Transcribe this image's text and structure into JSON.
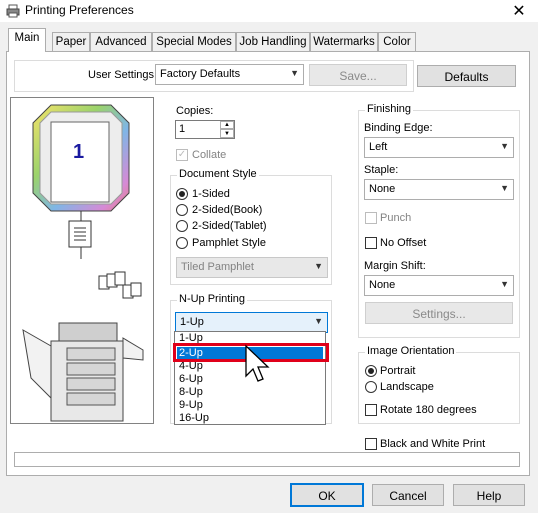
{
  "window": {
    "title": "Printing Preferences",
    "close_glyph": "✕"
  },
  "tabs": [
    "Main",
    "Paper",
    "Advanced",
    "Special Modes",
    "Job Handling",
    "Watermarks",
    "Color"
  ],
  "user_settings": {
    "label": "User Settings:",
    "value": "Factory Defaults",
    "save": "Save...",
    "defaults": "Defaults"
  },
  "preview": {
    "page_number": "1"
  },
  "copies": {
    "label": "Copies:",
    "value": "1",
    "collate": "Collate"
  },
  "document_style": {
    "title": "Document Style",
    "options": [
      "1-Sided",
      "2-Sided(Book)",
      "2-Sided(Tablet)",
      "Pamphlet Style"
    ],
    "selected": "1-Sided",
    "pamphlet_select": "Tiled Pamphlet"
  },
  "nup": {
    "title": "N-Up Printing",
    "value": "1-Up",
    "options": [
      "1-Up",
      "2-Up",
      "4-Up",
      "6-Up",
      "8-Up",
      "9-Up",
      "16-Up"
    ],
    "highlighted": "2-Up"
  },
  "finishing": {
    "title": "Finishing",
    "binding_label": "Binding Edge:",
    "binding_value": "Left",
    "staple_label": "Staple:",
    "staple_value": "None",
    "punch": "Punch",
    "no_offset": "No Offset",
    "margin_label": "Margin Shift:",
    "margin_value": "None",
    "settings": "Settings..."
  },
  "orientation": {
    "title": "Image Orientation",
    "options": [
      "Portrait",
      "Landscape"
    ],
    "selected": "Portrait",
    "rotate": "Rotate 180 degrees"
  },
  "bw": "Black and White Print",
  "buttons": {
    "ok": "OK",
    "cancel": "Cancel",
    "help": "Help"
  },
  "colors": {
    "accent": "#0078d7",
    "highlight_box": "#e0001a"
  }
}
